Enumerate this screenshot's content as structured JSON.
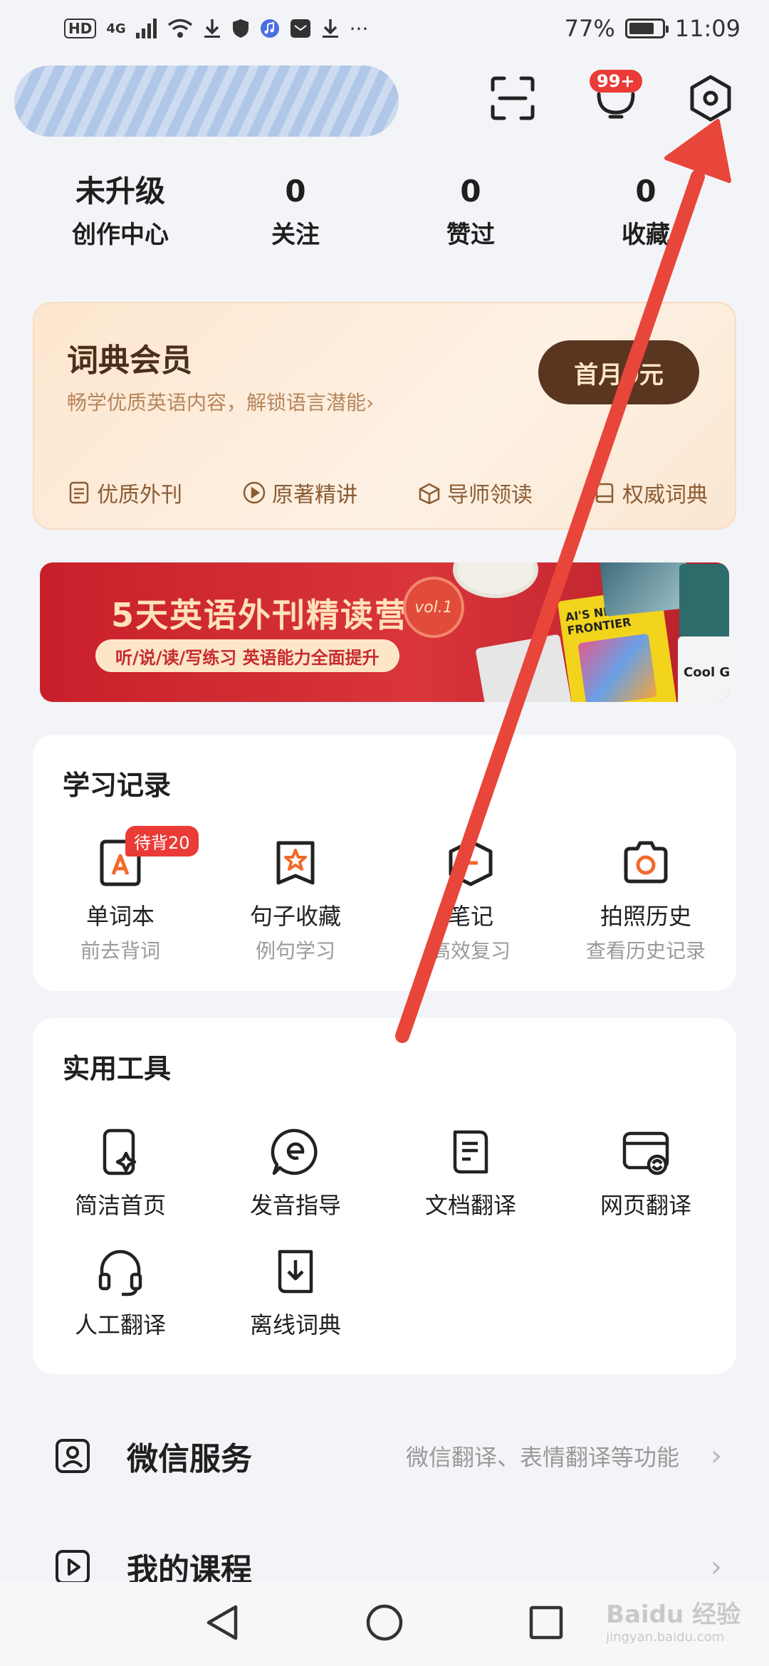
{
  "status_bar": {
    "hd": "HD",
    "network": "4G",
    "more": "···",
    "battery": "77%",
    "battery_level": 0.77,
    "time": "11:09"
  },
  "header": {
    "notification_badge": "99+"
  },
  "stats": [
    {
      "top": "未升级",
      "bottom": "创作中心"
    },
    {
      "top": "0",
      "bottom": "关注"
    },
    {
      "top": "0",
      "bottom": "赞过"
    },
    {
      "top": "0",
      "bottom": "收藏"
    }
  ],
  "vip": {
    "title": "词典会员",
    "subtitle": "畅学优质英语内容，解锁语言潜能›",
    "button": "首月0元",
    "features": [
      "优质外刊",
      "原著精讲",
      "导师领读",
      "权威词典"
    ]
  },
  "banner": {
    "title": "5天英语外刊精读营",
    "pill": "听/说/读/写练习   英语能力全面提升",
    "vol": "vol.1",
    "book_title": "AI'S NEW FRONTIER",
    "cool": "Cool G"
  },
  "study": {
    "title": "学习记录",
    "items": [
      {
        "label": "单词本",
        "sub": "前去背词",
        "badge": "待背20"
      },
      {
        "label": "句子收藏",
        "sub": "例句学习"
      },
      {
        "label": "笔记",
        "sub": "高效复习"
      },
      {
        "label": "拍照历史",
        "sub": "查看历史记录"
      }
    ]
  },
  "tools": {
    "title": "实用工具",
    "items": [
      {
        "label": "简洁首页"
      },
      {
        "label": "发音指导"
      },
      {
        "label": "文档翻译"
      },
      {
        "label": "网页翻译"
      },
      {
        "label": "人工翻译"
      },
      {
        "label": "离线词典"
      }
    ]
  },
  "rows": [
    {
      "title": "微信服务",
      "desc": "微信翻译、表情翻译等功能",
      "chevron": "›"
    },
    {
      "title": "我的课程",
      "desc": "",
      "chevron": "›"
    }
  ],
  "watermark": {
    "brand": "Baidu 经验",
    "url": "jingyan.baidu.com"
  },
  "colors": {
    "accent_red": "#ea3b37",
    "vip_brown": "#5a3520",
    "arrow_red": "#e8463a"
  }
}
